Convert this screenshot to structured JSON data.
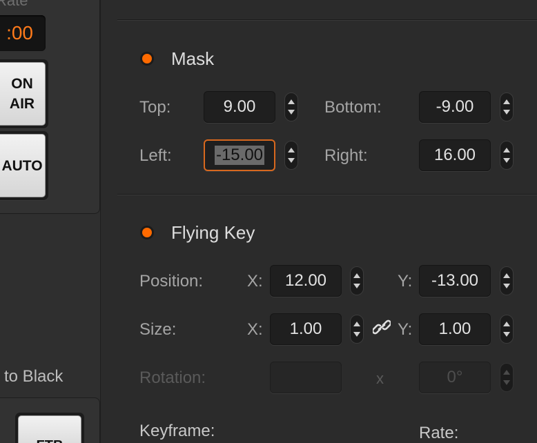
{
  "left_panel": {
    "rate_label": "Rate",
    "time_display": ":00",
    "on_air_button": "ON\nAIR",
    "auto_button": "AUTO",
    "fade_to_black_label": "to Black",
    "ftb_button": "FTB"
  },
  "mask": {
    "title": "Mask",
    "top_label": "Top:",
    "top_value": "9.00",
    "bottom_label": "Bottom:",
    "bottom_value": "-9.00",
    "left_label": "Left:",
    "left_value": "-15.00",
    "right_label": "Right:",
    "right_value": "16.00"
  },
  "flying_key": {
    "title": "Flying Key",
    "position_label": "Position:",
    "position_x_axis": "X:",
    "position_x_value": "12.00",
    "position_y_axis": "Y:",
    "position_y_value": "-13.00",
    "size_label": "Size:",
    "size_x_axis": "X:",
    "size_x_value": "1.00",
    "size_y_axis": "Y:",
    "size_y_value": "1.00",
    "rotation_label": "Rotation:",
    "rotation_x_value": "",
    "rotation_x_axis": "x",
    "rotation_value": "0°",
    "keyframe_label": "Keyframe:",
    "rate_label": "Rate:"
  },
  "colors": {
    "accent": "#ff6a00",
    "background": "#2b2b2b",
    "field_bg": "#1f1f1f"
  }
}
